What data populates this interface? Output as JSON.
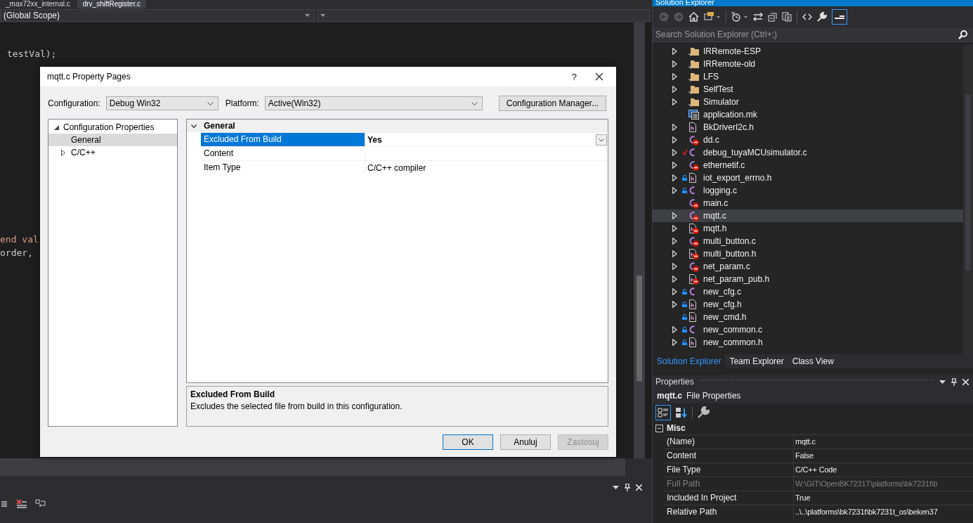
{
  "editor": {
    "tabs": [
      {
        "label": "_max72xx_internal.c",
        "selected": false
      },
      {
        "label": "drv_shiftRegister.c",
        "selected": true
      }
    ],
    "scope": "(Global Scope)",
    "code_lines": [
      {
        "text": "testVal);",
        "kind": "plain"
      },
      {
        "text": "end val",
        "kind": "string"
      },
      {
        "text": "order,",
        "kind": "plain"
      }
    ]
  },
  "dialog": {
    "title": "mqtt.c Property Pages",
    "help": "?",
    "configuration": {
      "label": "Configuration:",
      "value": "Debug Win32"
    },
    "platform": {
      "label": "Platform:",
      "value": "Active(Win32)"
    },
    "config_manager": "Configuration Manager...",
    "tree": [
      {
        "label": "Configuration Properties",
        "expanded": true,
        "selected": false,
        "children": [
          {
            "label": "General",
            "selected": true
          },
          {
            "label": "C/C++",
            "expanded": false,
            "selected": false
          }
        ]
      }
    ],
    "grid": {
      "section": "General",
      "expanded": true,
      "rows": [
        {
          "name": "Excluded From Build",
          "value": "Yes",
          "selected": true
        },
        {
          "name": "Content",
          "selected": false
        },
        {
          "name": "Item Type",
          "value": "C/C++ compiler",
          "selected": false
        }
      ]
    },
    "description": {
      "title": "Excluded From Build",
      "text": "Excludes the selected file from build in this configuration."
    },
    "buttons": [
      {
        "label": "OK",
        "kind": "default",
        "disabled": false
      },
      {
        "label": "Anuluj",
        "kind": "normal",
        "disabled": false
      },
      {
        "label": "Zastosuj",
        "kind": "normal",
        "disabled": true
      }
    ]
  },
  "solution_explorer": {
    "title": "Solution Explorer",
    "search": {
      "placeholder": "Search Solution Explorer (Ctrl+;)"
    },
    "items": [
      {
        "label": "IRRemote-ESP",
        "kind": "folder",
        "expandable": true,
        "locked": false,
        "excluded": false,
        "checked_out": false,
        "selected": false
      },
      {
        "label": "IRRemote-old",
        "kind": "folder",
        "expandable": true,
        "locked": false,
        "excluded": false,
        "checked_out": false,
        "selected": false
      },
      {
        "label": "LFS",
        "kind": "folder",
        "expandable": true,
        "locked": false,
        "excluded": false,
        "checked_out": false,
        "selected": false
      },
      {
        "label": "SelfTest",
        "kind": "folder",
        "expandable": true,
        "locked": false,
        "excluded": false,
        "checked_out": false,
        "selected": false
      },
      {
        "label": "Simulator",
        "kind": "folder",
        "expandable": true,
        "locked": false,
        "excluded": false,
        "checked_out": false,
        "selected": false
      },
      {
        "label": "application.mk",
        "kind": "make",
        "expandable": false,
        "locked": false,
        "excluded": false,
        "checked_out": false,
        "selected": false
      },
      {
        "label": "BkDriverI2c.h",
        "kind": "header",
        "expandable": true,
        "locked": false,
        "excluded": false,
        "checked_out": false,
        "selected": false
      },
      {
        "label": "dd.c",
        "kind": "source",
        "expandable": true,
        "locked": false,
        "excluded": true,
        "checked_out": false,
        "selected": false
      },
      {
        "label": "debug_tuyaMCUsimulator.c",
        "kind": "source",
        "expandable": true,
        "locked": false,
        "excluded": false,
        "checked_out": true,
        "selected": false
      },
      {
        "label": "ethernetif.c",
        "kind": "source",
        "expandable": true,
        "locked": false,
        "excluded": true,
        "checked_out": false,
        "selected": false
      },
      {
        "label": "iot_export_errno.h",
        "kind": "header",
        "expandable": true,
        "locked": true,
        "excluded": false,
        "checked_out": false,
        "selected": false
      },
      {
        "label": "logging.c",
        "kind": "source",
        "expandable": true,
        "locked": true,
        "excluded": false,
        "checked_out": false,
        "selected": false
      },
      {
        "label": "main.c",
        "kind": "source",
        "expandable": false,
        "locked": false,
        "excluded": true,
        "checked_out": false,
        "selected": false
      },
      {
        "label": "mqtt.c",
        "kind": "source",
        "expandable": true,
        "locked": false,
        "excluded": true,
        "checked_out": false,
        "selected": true
      },
      {
        "label": "mqtt.h",
        "kind": "header",
        "expandable": true,
        "locked": false,
        "excluded": true,
        "checked_out": false,
        "selected": false
      },
      {
        "label": "multi_button.c",
        "kind": "source",
        "expandable": true,
        "locked": false,
        "excluded": true,
        "checked_out": false,
        "selected": false
      },
      {
        "label": "multi_button.h",
        "kind": "header",
        "expandable": true,
        "locked": false,
        "excluded": true,
        "checked_out": false,
        "selected": false
      },
      {
        "label": "net_param.c",
        "kind": "source",
        "expandable": true,
        "locked": false,
        "excluded": true,
        "checked_out": false,
        "selected": false
      },
      {
        "label": "net_param_pub.h",
        "kind": "header",
        "expandable": true,
        "locked": false,
        "excluded": true,
        "checked_out": false,
        "selected": false
      },
      {
        "label": "new_cfg.c",
        "kind": "source",
        "expandable": true,
        "locked": true,
        "excluded": false,
        "checked_out": false,
        "selected": false
      },
      {
        "label": "new_cfg.h",
        "kind": "header",
        "expandable": true,
        "locked": true,
        "excluded": false,
        "checked_out": false,
        "selected": false
      },
      {
        "label": "new_cmd.h",
        "kind": "header",
        "expandable": false,
        "locked": true,
        "excluded": false,
        "checked_out": false,
        "selected": false
      },
      {
        "label": "new_common.c",
        "kind": "source",
        "expandable": true,
        "locked": true,
        "excluded": false,
        "checked_out": false,
        "selected": false
      },
      {
        "label": "new_common.h",
        "kind": "header",
        "expandable": true,
        "locked": true,
        "excluded": false,
        "checked_out": false,
        "selected": false
      }
    ],
    "tabs": [
      {
        "label": "Solution Explorer",
        "selected": true
      },
      {
        "label": "Team Explorer",
        "selected": false
      },
      {
        "label": "Class View",
        "selected": false
      }
    ]
  },
  "properties": {
    "title": "Properties",
    "object": "mqtt.c",
    "object_type": "File Properties",
    "section": "Misc",
    "expanded": true,
    "rows": [
      {
        "name": "(Name)",
        "value": "mqtt.c",
        "disabled": false
      },
      {
        "name": "Content",
        "value": "False",
        "disabled": false
      },
      {
        "name": "File Type",
        "value": "C/C++ Code",
        "disabled": false
      },
      {
        "name": "Full Path",
        "value": "W:\\GIT\\OpenBK7231T\\platforms\\bk7231t\\b",
        "disabled": true
      },
      {
        "name": "Included In Project",
        "value": "True",
        "disabled": false
      },
      {
        "name": "Relative Path",
        "value": "..\\..\\platforms\\bk7231t\\bk7231t_os\\beken37",
        "disabled": false
      }
    ]
  }
}
